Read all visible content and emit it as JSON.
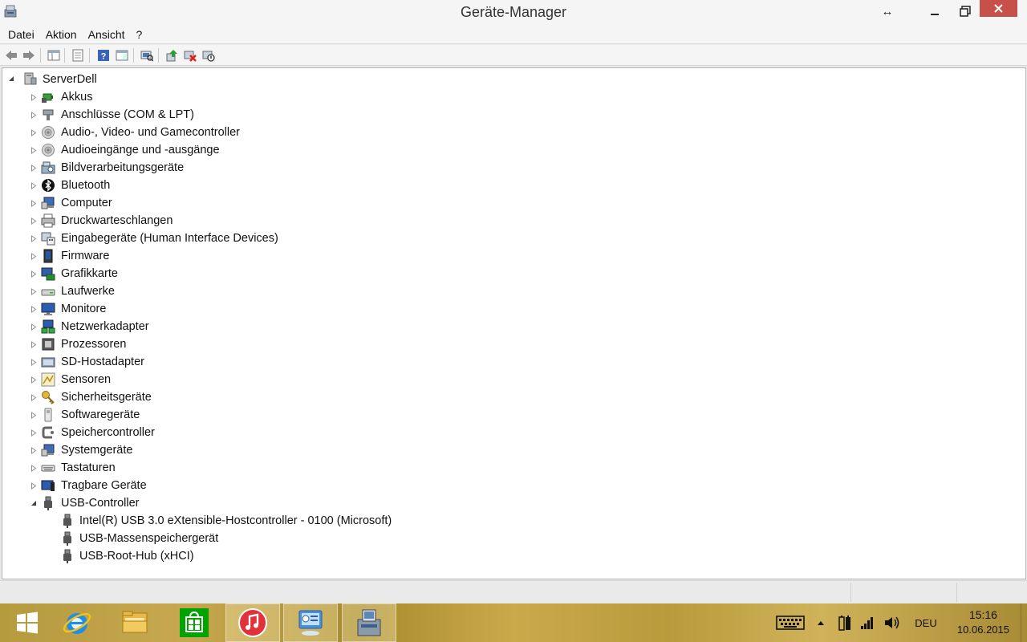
{
  "window": {
    "title": "Geräte-Manager"
  },
  "menu": [
    "Datei",
    "Aktion",
    "Ansicht",
    "?"
  ],
  "toolbar": {
    "buttons": [
      "back",
      "forward",
      "show-hide-console-tree",
      "properties",
      "help",
      "action-pane",
      "scan-hardware",
      "update-driver",
      "uninstall",
      "disable"
    ]
  },
  "tree": {
    "root": "ServerDell",
    "categories": [
      {
        "label": "Akkus",
        "icon": "battery-icon",
        "expanded": false
      },
      {
        "label": "Anschlüsse (COM & LPT)",
        "icon": "port-icon",
        "expanded": false
      },
      {
        "label": "Audio-, Video- und Gamecontroller",
        "icon": "speaker-icon",
        "expanded": false
      },
      {
        "label": "Audioeingänge und -ausgänge",
        "icon": "speaker-icon",
        "expanded": false
      },
      {
        "label": "Bildverarbeitungsgeräte",
        "icon": "camera-icon",
        "expanded": false
      },
      {
        "label": "Bluetooth",
        "icon": "bluetooth-icon",
        "expanded": false
      },
      {
        "label": "Computer",
        "icon": "computer-icon",
        "expanded": false
      },
      {
        "label": "Druckwarteschlangen",
        "icon": "printer-icon",
        "expanded": false
      },
      {
        "label": "Eingabegeräte (Human Interface Devices)",
        "icon": "hid-icon",
        "expanded": false
      },
      {
        "label": "Firmware",
        "icon": "firmware-icon",
        "expanded": false
      },
      {
        "label": "Grafikkarte",
        "icon": "display-adapter-icon",
        "expanded": false
      },
      {
        "label": "Laufwerke",
        "icon": "disk-drive-icon",
        "expanded": false
      },
      {
        "label": "Monitore",
        "icon": "monitor-icon",
        "expanded": false
      },
      {
        "label": "Netzwerkadapter",
        "icon": "network-icon",
        "expanded": false
      },
      {
        "label": "Prozessoren",
        "icon": "processor-icon",
        "expanded": false
      },
      {
        "label": "SD-Hostadapter",
        "icon": "sd-card-icon",
        "expanded": false
      },
      {
        "label": "Sensoren",
        "icon": "sensor-icon",
        "expanded": false
      },
      {
        "label": "Sicherheitsgeräte",
        "icon": "key-icon",
        "expanded": false
      },
      {
        "label": "Softwaregeräte",
        "icon": "software-device-icon",
        "expanded": false
      },
      {
        "label": "Speichercontroller",
        "icon": "storage-controller-icon",
        "expanded": false
      },
      {
        "label": "Systemgeräte",
        "icon": "system-device-icon",
        "expanded": false
      },
      {
        "label": "Tastaturen",
        "icon": "keyboard-icon",
        "expanded": false
      },
      {
        "label": "Tragbare Geräte",
        "icon": "portable-device-icon",
        "expanded": false
      },
      {
        "label": "USB-Controller",
        "icon": "usb-icon",
        "expanded": true
      }
    ],
    "usb_children": [
      "Intel(R) USB 3.0 eXtensible-Hostcontroller - 0100 (Microsoft)",
      "USB-Massenspeichergerät",
      "USB-Root-Hub (xHCI)"
    ]
  },
  "taskbar": {
    "apps": [
      "start",
      "internet-explorer",
      "file-explorer",
      "windows-store",
      "itunes",
      "control-panel",
      "device-manager"
    ],
    "language": "DEU",
    "time": "15:16",
    "date": "10.06.2015"
  },
  "colors": {
    "close_button": "#c7504a",
    "taskbar": "#b99b3c",
    "tree_background": "#ffffff"
  }
}
